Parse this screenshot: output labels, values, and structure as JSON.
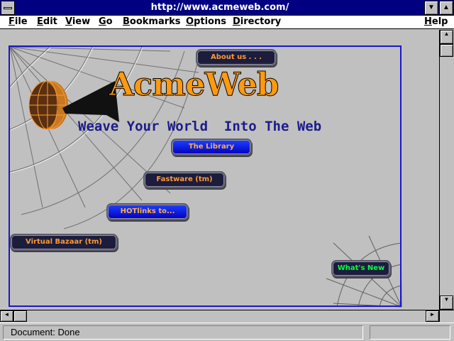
{
  "window": {
    "title": "http://www.acmeweb.com/",
    "minimize_glyph": "▼",
    "maximize_glyph": "▲"
  },
  "menu": {
    "items": [
      "File",
      "Edit",
      "View",
      "Go",
      "Bookmarks",
      "Options",
      "Directory"
    ],
    "help": "Help"
  },
  "page": {
    "logo_text": "AcmeWeb",
    "tagline": "Weave Your World  Into The Web",
    "links": [
      {
        "label": "About us . . ."
      },
      {
        "label": "The Library"
      },
      {
        "label": "Fastware (tm)"
      },
      {
        "label": "HOTlinks to..."
      },
      {
        "label": "Virtual Bazaar (tm)"
      },
      {
        "label": "What's New"
      }
    ],
    "colors": {
      "frame": "#1818c8",
      "logo": "#ff9a10",
      "tagline": "#1c1c8c",
      "link_orange": "#ff9933",
      "link_green": "#00ff40"
    }
  },
  "status": {
    "text": "Document: Done"
  },
  "icons": {
    "system_menu": "system-menu-icon",
    "minimize": "minimize-icon",
    "maximize": "maximize-icon",
    "scroll_up": "scroll-up-icon",
    "scroll_down": "scroll-down-icon",
    "scroll_left": "scroll-left-icon",
    "scroll_right": "scroll-right-icon",
    "globe": "globe-icon"
  }
}
